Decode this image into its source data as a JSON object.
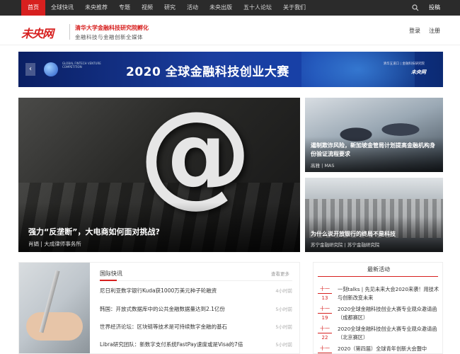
{
  "nav": {
    "items": [
      "首页",
      "全球快讯",
      "未央推荐",
      "专题",
      "视频",
      "研究",
      "活动",
      "未央出版",
      "五十人论坛",
      "关于我们"
    ],
    "submit_label": "投稿"
  },
  "header": {
    "logo": "未央网",
    "tagline1": "清华大学金融科技研究院孵化",
    "tagline2": "金融科技与金融创新全媒体",
    "login": "登录",
    "register": "注册"
  },
  "banner": {
    "title": "2020 全球金融科技创业大赛",
    "left_small": "GLOBAL FINTECH VENTURE COMPETITION",
    "right_small": "清华五道口 | 金融科技研究院",
    "right_brand": "未央网"
  },
  "hero": {
    "title": "强力“反垄断”，大电商如何面对挑战?",
    "meta": "肖娟 | 大成律师事务所"
  },
  "side_cards": [
    {
      "title": "遏制欺诈风险，新加坡金管局计划提高金融机构身份验证流程要求",
      "meta": "高雅 | MAS"
    },
    {
      "title": "为什么说开放银行的终局不是科技",
      "meta": "苏宁金融研究院 | 苏宁金融研究院"
    }
  ],
  "news": {
    "heading": "国际快讯",
    "more": "查看更多",
    "items": [
      {
        "title": "尼日利亚数字银行Kuda获1000万美元种子轮融资",
        "time": "4小时前"
      },
      {
        "title": "韩国：开放式数据库中的公共金融数据量达到2.1亿份",
        "time": "5小时前"
      },
      {
        "title": "世界经济论坛：区块链等技术是可持续数字金融的基石",
        "time": "5小时前"
      },
      {
        "title": "Libra研究团队：新数字支付系统FastPay速度或是Visa的7倍",
        "time": "5小时前"
      }
    ]
  },
  "events": {
    "heading": "最新活动",
    "items": [
      {
        "month": "十一",
        "day": "13",
        "title": "一刻talks | 先见未来大会2020来袭！用技术与创新改变未来"
      },
      {
        "month": "十一",
        "day": "19",
        "title": "2020全球金融科技创业大赛专业观众邀请函（成都赛区）"
      },
      {
        "month": "十一",
        "day": "22",
        "title": "2020全球金融科技创业大赛专业观众邀请函（北京赛区）"
      },
      {
        "month": "十一",
        "day": "",
        "title": "2020（第四届）全球青年创新大会暨中"
      }
    ]
  }
}
